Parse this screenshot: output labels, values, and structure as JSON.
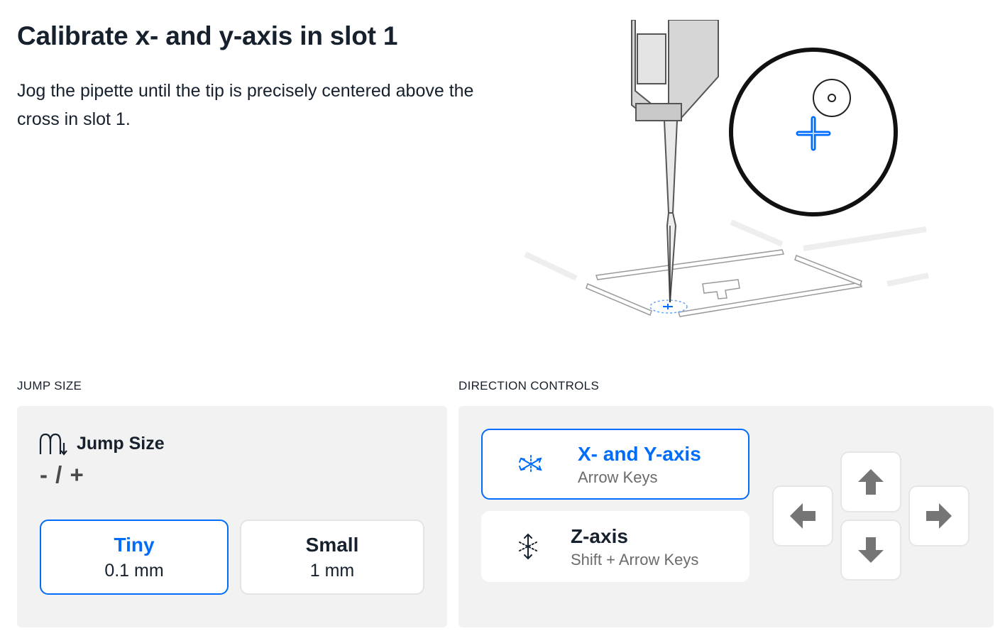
{
  "header": {
    "title": "Calibrate x- and y-axis in slot 1",
    "instructions": "Jog the pipette until the tip is precisely centered above the cross in slot 1.",
    "illustration_slot_number": "1"
  },
  "jump_size": {
    "section_label": "JUMP SIZE",
    "heading": "Jump Size",
    "heading_icon": "jump-size-icon",
    "keys": "- / +",
    "options": [
      {
        "name": "Tiny",
        "value": "0.1 mm",
        "selected": true
      },
      {
        "name": "Small",
        "value": "1 mm",
        "selected": false
      }
    ]
  },
  "direction_controls": {
    "section_label": "DIRECTION CONTROLS",
    "axes": [
      {
        "name": "X- and Y-axis",
        "keys": "Arrow Keys",
        "icon": "xy-axis-icon",
        "selected": true
      },
      {
        "name": "Z-axis",
        "keys": "Shift + Arrow Keys",
        "icon": "z-axis-icon",
        "selected": false
      }
    ],
    "arrows": [
      "arrow-up-icon",
      "arrow-left-icon",
      "arrow-down-icon",
      "arrow-right-icon"
    ]
  },
  "colors": {
    "accent": "#006cfa",
    "text": "#16212d",
    "panel_background": "#f2f2f2",
    "arrow_icon": "#757575"
  }
}
